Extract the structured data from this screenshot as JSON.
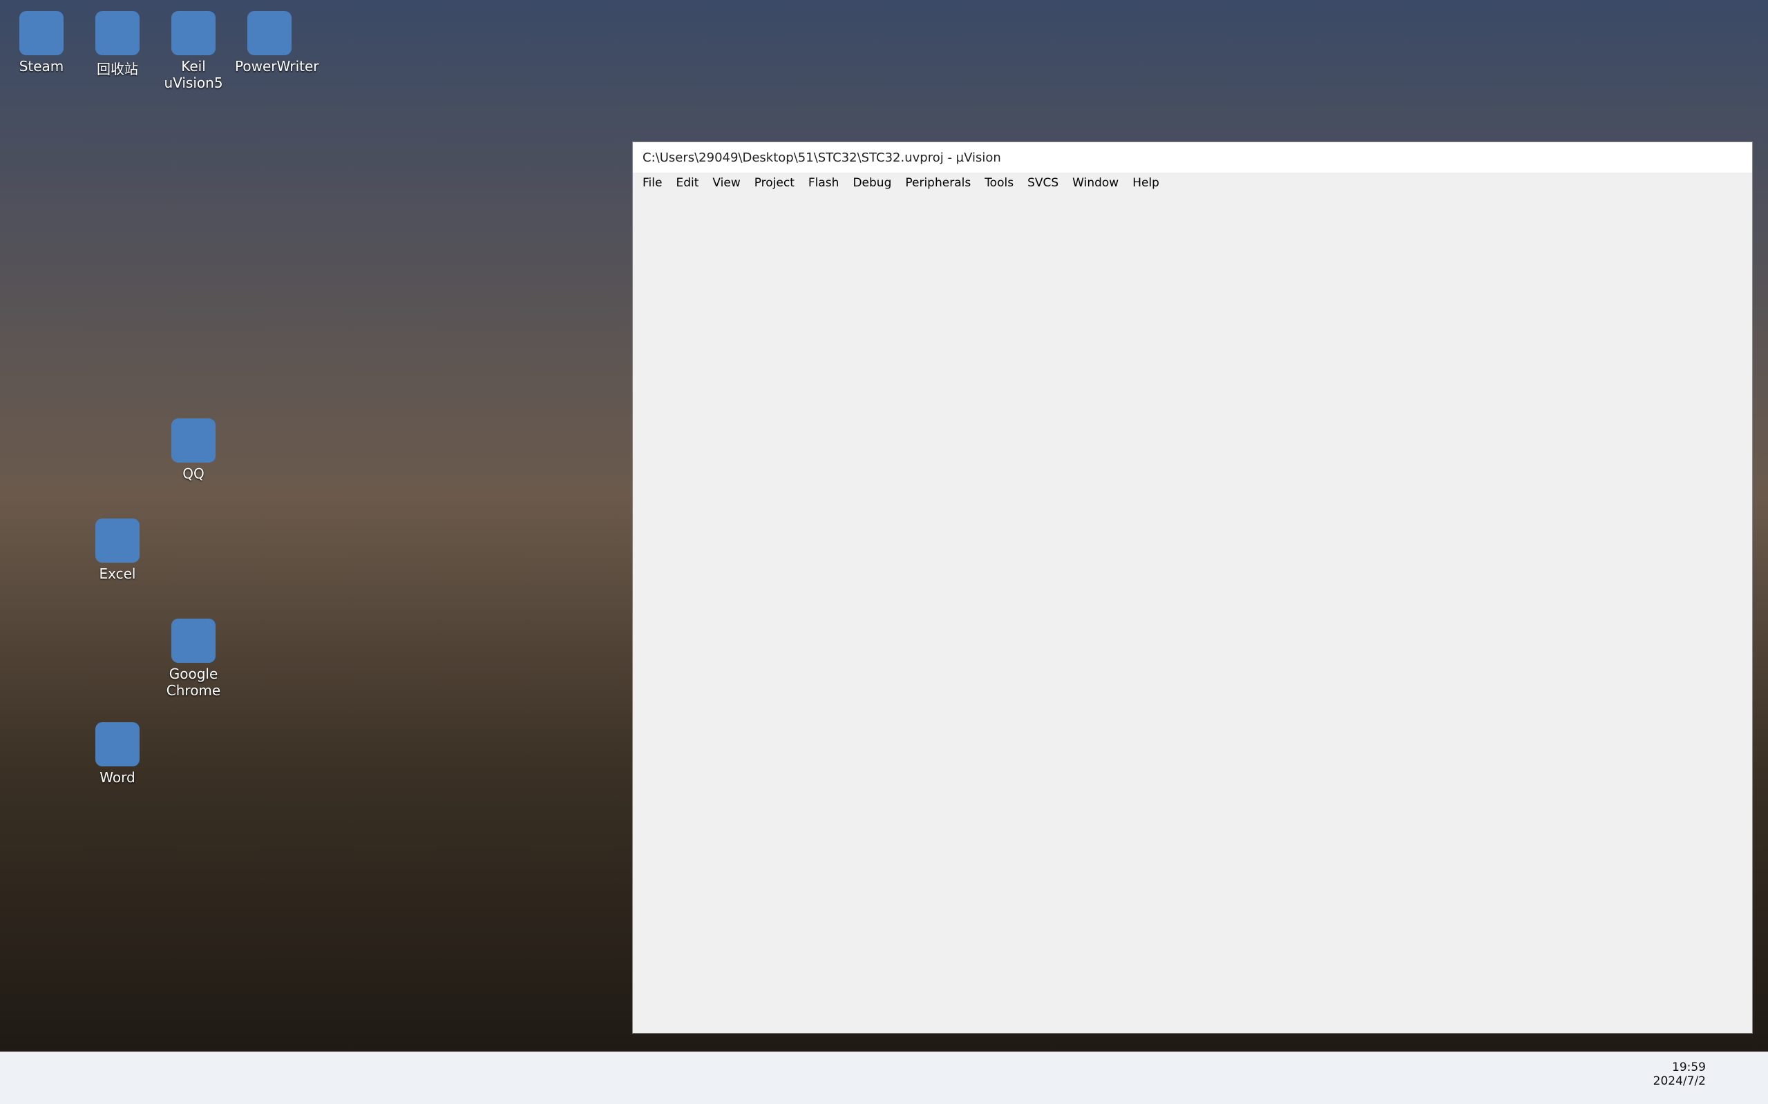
{
  "desktop": {
    "icons": [
      {
        "label": "Steam"
      },
      {
        "label": "回收站"
      },
      {
        "label": "Keil uVision5"
      },
      {
        "label": "PowerWriter"
      },
      {
        "label": "Word"
      },
      {
        "label": "Google Chrome"
      },
      {
        "label": "QQ"
      },
      {
        "label": "Excel"
      }
    ]
  },
  "window": {
    "title": "C:\\Users\\29049\\Desktop\\51\\STC32\\STC32.uvproj - µVision",
    "menu": [
      "File",
      "Edit",
      "View",
      "Project",
      "Flash",
      "Debug",
      "Peripherals",
      "Tools",
      "SVCS",
      "Window",
      "Help"
    ]
  },
  "taskbar": {
    "time": "19:59",
    "date": "2024/7/2"
  }
}
